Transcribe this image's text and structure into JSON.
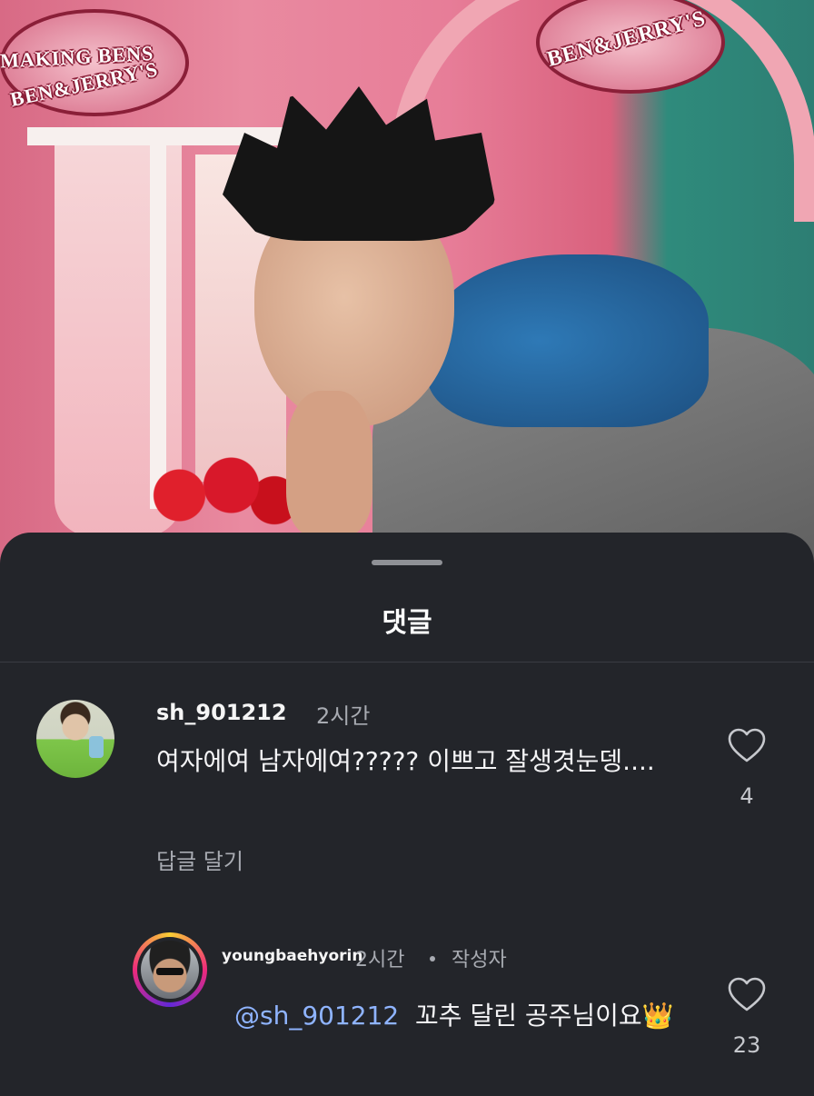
{
  "photo": {
    "sign_left_top": "MAKING BENS",
    "sign_left_bottom": "BEN&JERRY'S",
    "sign_right": "BEN&JERRY'S"
  },
  "sheet": {
    "title": "댓글"
  },
  "comments": [
    {
      "username": "sh_901212",
      "time": "2시간",
      "text": "여자에여 남자에여????? 이쁘고 잘생겻눈뎅....",
      "reply_label": "답글 달기",
      "likes": "4"
    }
  ],
  "reply": {
    "username": "youngbaehyorin",
    "time": "2시간",
    "author_tag": "작성자",
    "mention": "@sh_901212",
    "text": "꼬추 달린 공주님이요👑",
    "likes": "23"
  },
  "colors": {
    "sheet_bg": "#23252a",
    "mention": "#8fb4ff",
    "secondary_text": "#a8abb2"
  },
  "icons": {
    "like": "heart-outline-icon"
  }
}
